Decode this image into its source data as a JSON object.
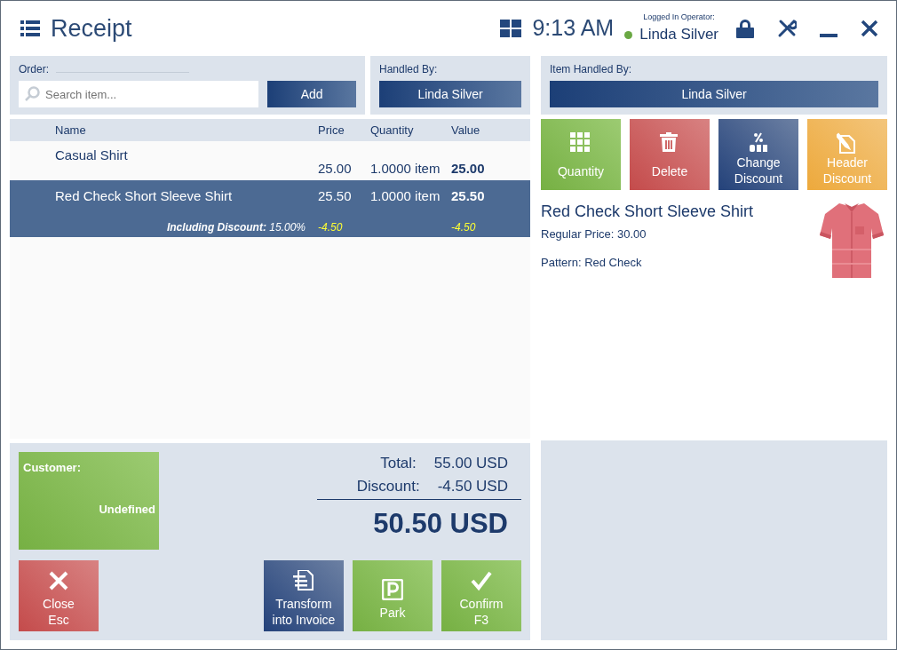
{
  "window": {
    "title": "Receipt",
    "time": "9:13 AM",
    "operator_label": "Logged In Operator:",
    "operator": "Linda Silver",
    "online": true
  },
  "order": {
    "label": "Order:",
    "search": {
      "placeholder": "Search item..."
    },
    "add_button": "Add"
  },
  "handled_by": {
    "label": "Handled By:",
    "value": "Linda Silver"
  },
  "item_handled_by": {
    "label": "Item Handled By:",
    "value": "Linda Silver"
  },
  "table": {
    "columns": [
      "Name",
      "Price",
      "Quantity",
      "Value"
    ],
    "rows": [
      {
        "name": "Casual Shirt",
        "price": "25.00",
        "quantity": "1.0000 item",
        "value": "25.00",
        "selected": false
      },
      {
        "name": "Red Check Short Sleeve Shirt",
        "price": "25.50",
        "quantity": "1.0000 item",
        "value": "25.50",
        "selected": true,
        "discount": {
          "text": "**Including Discount:** 15.00%",
          "price": "-4.50",
          "value": "-4.50"
        }
      }
    ]
  },
  "item_actions": [
    {
      "kind": "quantity",
      "label": "Quantity"
    },
    {
      "kind": "delete",
      "label": "Delete"
    },
    {
      "kind": "change-discount",
      "label": "Change Discount"
    },
    {
      "kind": "header-discount",
      "label": "Header Discount"
    }
  ],
  "item_info": {
    "name": "Red Check Short Sleeve Shirt",
    "lines": [
      "Regular Price: 30.00",
      "Pattern: Red Check"
    ]
  },
  "customer": {
    "label": "Customer:",
    "value": "Undefined"
  },
  "totals": {
    "total_label": "Total:",
    "total": "55.00 USD",
    "discount_label": "Discount:",
    "discount": "-4.50 USD",
    "grand_total": "50.50 USD"
  },
  "actions": [
    {
      "kind": "close",
      "lines": [
        "Close",
        "Esc"
      ]
    },
    {
      "kind": "invoice",
      "lines": [
        "Transform",
        "into Invoice"
      ]
    },
    {
      "kind": "park",
      "lines": [
        "Park"
      ]
    },
    {
      "kind": "confirm",
      "lines": [
        "Confirm",
        "F3"
      ]
    }
  ]
}
